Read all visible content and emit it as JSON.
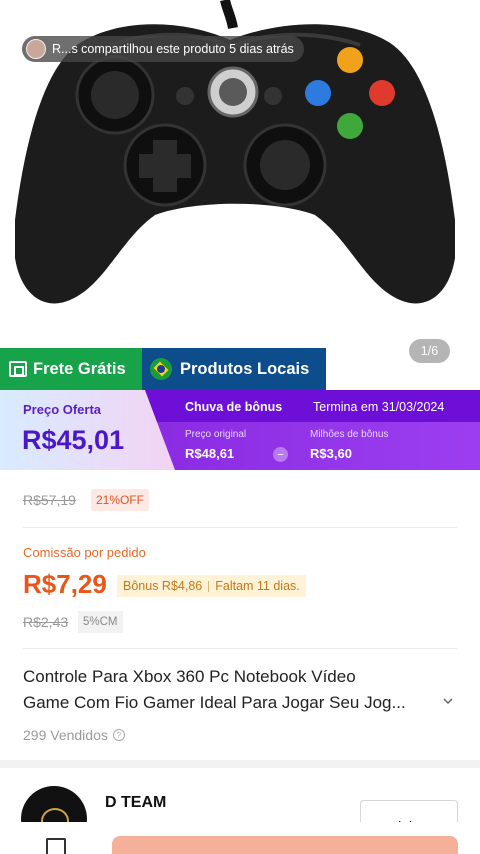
{
  "share": {
    "text": "R...s compartilhou este produto 5 dias atrás"
  },
  "gallery": {
    "counter": "1/6"
  },
  "badges": {
    "frete": "Frete Grátis",
    "local": "Produtos Locais"
  },
  "offer": {
    "label": "Preço Oferta",
    "price": "R$45,01",
    "bonus_title": "Chuva de bônus",
    "ends": "Termina em 31/03/2024",
    "original_label": "Preço original",
    "original_value": "R$48,61",
    "operator": "−",
    "bonus_label": "Milhões de bônus",
    "bonus_value": "R$3,60"
  },
  "price": {
    "old": "R$57,19",
    "discount": "21%OFF"
  },
  "commission": {
    "label": "Comissão por pedido",
    "value": "R$7,29",
    "bonus": "Bônus R$4,86",
    "remaining": "Faltam 11 dias.",
    "old": "R$2,43",
    "cm": "5%CM"
  },
  "product": {
    "title_line1": "Controle Para Xbox 360 Pc Notebook Vídeo",
    "title_line2": "Game Com Fio Gamer Ideal Para Jogar Seu Jog...",
    "sold": "299 Vendidos"
  },
  "shop": {
    "name": "D TEAM",
    "visit_label": "Visitar"
  },
  "colors": {
    "green": "#16a34a",
    "navy": "#0d4d8c",
    "purple": "#8a2be2",
    "orange": "#e8561a"
  }
}
